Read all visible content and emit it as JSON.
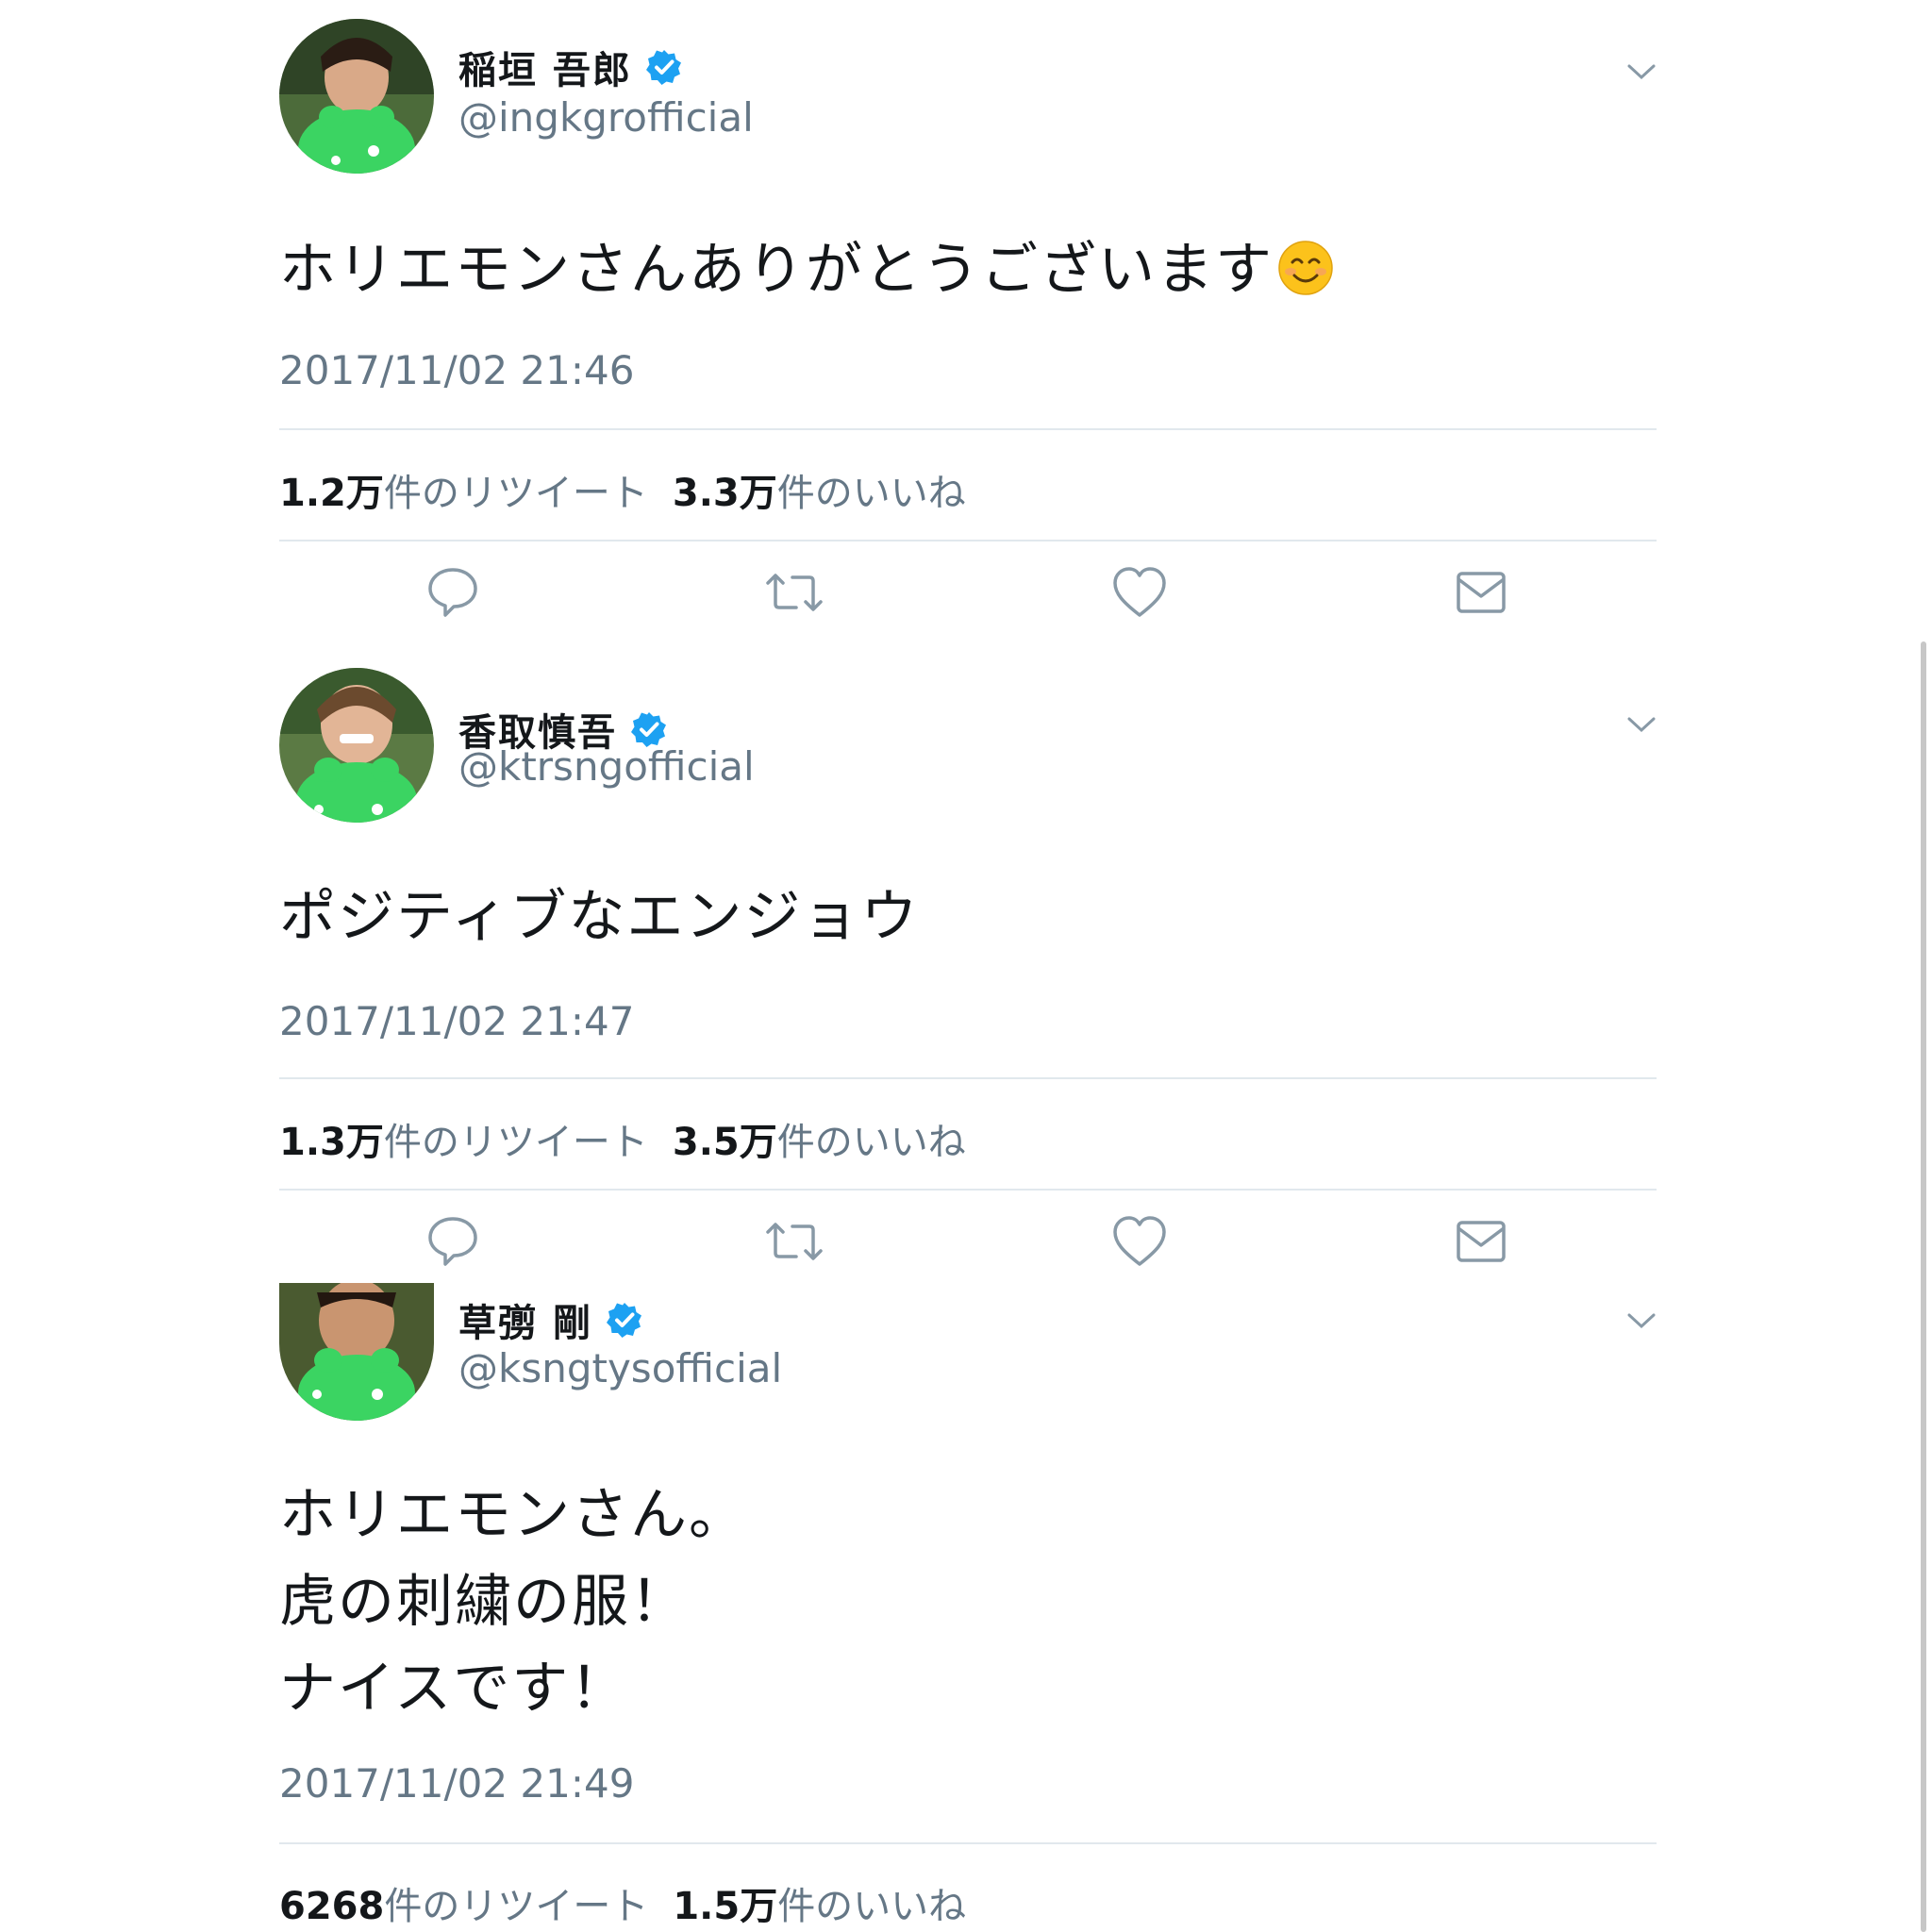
{
  "colors": {
    "text": "#14171a",
    "secondary": "#657786",
    "divider": "#e1e8ed",
    "verified": "#1da1f2"
  },
  "tweets": [
    {
      "display_name": "稲垣 吾郎",
      "handle": "@ingkgrofficial",
      "text": "ホリエモンさんありがとうございます",
      "emoji": "smiling-face-icon",
      "timestamp": "2017/11/02 21:46",
      "retweets_count": "1.2万",
      "retweets_label": "件のリツイート",
      "likes_count": "3.3万",
      "likes_label": "件のいいね"
    },
    {
      "display_name": "香取慎吾",
      "handle": "@ktrsngofficial",
      "text": "ポジティブなエンジョウ",
      "timestamp": "2017/11/02 21:47",
      "retweets_count": "1.3万",
      "retweets_label": "件のリツイート",
      "likes_count": "3.5万",
      "likes_label": "件のいいね"
    },
    {
      "display_name": "草彅 剛",
      "handle": "@ksngtysofficial",
      "text": "ホリエモンさん。\n虎の刺繍の服！\nナイスです！",
      "timestamp": "2017/11/02 21:49",
      "retweets_count": "6268",
      "retweets_label": "件のリツイート",
      "likes_count": "1.5万",
      "likes_label": "件のいいね"
    }
  ],
  "actions": [
    "reply-icon",
    "retweet-icon",
    "like-icon",
    "direct-message-icon"
  ]
}
